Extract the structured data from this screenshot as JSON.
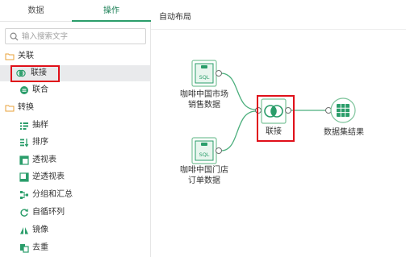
{
  "tabs": {
    "data_label": "数据",
    "ops_label": "操作"
  },
  "search": {
    "placeholder": "输入搜索文字"
  },
  "ops": {
    "cat_relate": "关联",
    "join": "联接",
    "union": "联合",
    "cat_transform": "转换",
    "sample": "抽样",
    "sort": "排序",
    "pivot": "透视表",
    "unpivot": "逆透视表",
    "group": "分组和汇总",
    "recursive": "自循环列",
    "mirror": "镜像",
    "dedup": "去重"
  },
  "canvas": {
    "title": "自动布局",
    "node1_line1": "咖啡中国市场",
    "node1_line2": "销售数据",
    "node2_line1": "咖啡中国门店",
    "node2_line2": "订单数据",
    "sql_tag": "SQL",
    "join_label": "联接",
    "result_label": "数据集结果"
  },
  "colors": {
    "accent": "#2a9d6a",
    "highlight": "#e0101a",
    "selected_bg": "#e9eaec"
  }
}
